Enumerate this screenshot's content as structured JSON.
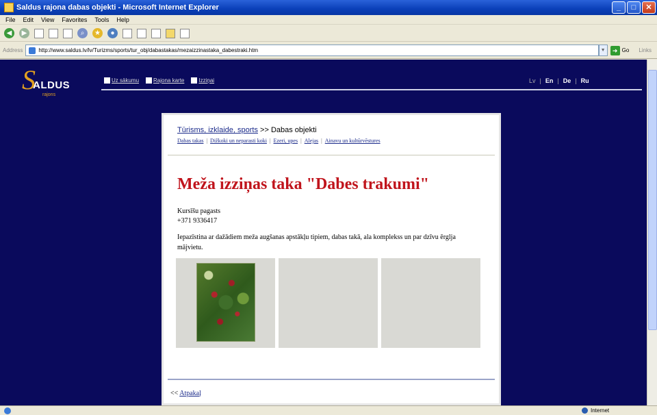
{
  "window": {
    "title": "Saldus rajona dabas objekti - Microsoft Internet Explorer"
  },
  "menu": [
    "File",
    "Edit",
    "View",
    "Favorites",
    "Tools",
    "Help"
  ],
  "address": {
    "label": "Address",
    "url": "http://www.saldus.lv/lv/Turizms/sports/tur_obj/dabastakas/mezaizzinastaka_dabestraki.htm",
    "go_label": "Go",
    "links_label": "Links"
  },
  "site": {
    "logo_text": "ALDUS",
    "logo_initial": "S",
    "logo_sub": "rajons",
    "nav": [
      {
        "label": "Uz sākumu",
        "icon": "home-icon"
      },
      {
        "label": "Rajona karte",
        "icon": "map-icon"
      },
      {
        "label": "Izziņai",
        "icon": "info-icon"
      }
    ],
    "languages": {
      "current": "Lv",
      "others": [
        "En",
        "De",
        "Ru"
      ]
    }
  },
  "content": {
    "breadcrumb_link": "Tūrisms, izklaide, sports",
    "breadcrumb_sep": " >> ",
    "breadcrumb_current": "Dabas objekti",
    "subnav": [
      "Dabas takas",
      "Dižkoki un neparasti koki",
      "Ezeri, upes",
      "Alejas",
      "Ainavu un kultūrvēstures"
    ],
    "heading": "Meža izziņas taka \"Dabes trakumi\"",
    "location": "Kursīšu pagasts",
    "phone": "+371 9336417",
    "description": "Iepazīstina ar dažādiem meža augšanas apstākļu tipiem, dabas takā, ala komplekss un par dzīvu ērglja mājvietu.",
    "back_prefix": "<< ",
    "back_link": "Atpakaļ"
  },
  "status": {
    "zone": "Internet"
  },
  "colors": {
    "page_bg": "#0a0a5c",
    "heading": "#c0141c",
    "link": "#1a2a8a",
    "logo_accent": "#e2a020"
  }
}
